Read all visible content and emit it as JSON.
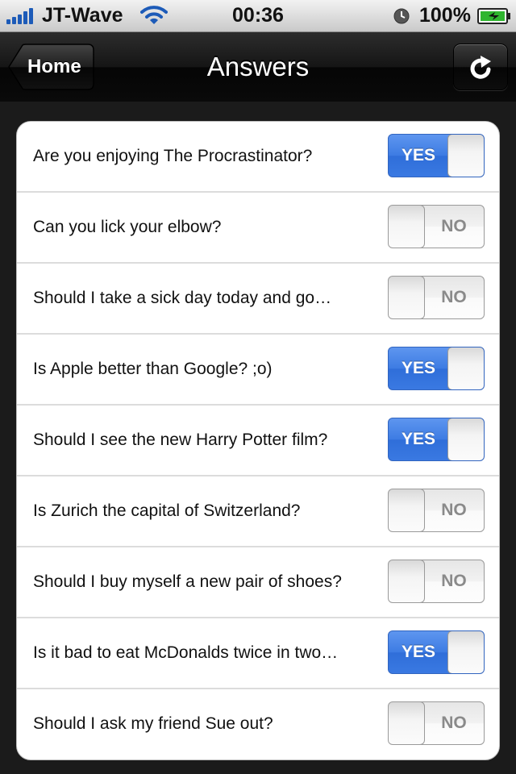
{
  "status_bar": {
    "carrier": "JT-Wave",
    "time": "00:36",
    "battery": "100%",
    "icons": [
      "signal-icon",
      "wifi-icon",
      "alarm-clock-icon",
      "battery-charging-icon"
    ]
  },
  "nav": {
    "back_label": "Home",
    "title": "Answers",
    "refresh_icon": "refresh-icon"
  },
  "colors": {
    "toggle_on": "#3d7ce3",
    "navbar": "#151515",
    "background": "#1b1b1b"
  },
  "rows": [
    {
      "question": "Are you enjoying The Procrastinator?",
      "answer": "YES",
      "on": true
    },
    {
      "question": "Can you lick your elbow?",
      "answer": "NO",
      "on": false
    },
    {
      "question": "Should I take a sick day today and go…",
      "answer": "NO",
      "on": false
    },
    {
      "question": "Is Apple better than Google? ;o)",
      "answer": "YES",
      "on": true
    },
    {
      "question": "Should I see the new Harry Potter film?",
      "answer": "YES",
      "on": true
    },
    {
      "question": "Is Zurich the capital of Switzerland?",
      "answer": "NO",
      "on": false
    },
    {
      "question": "Should I buy myself a new pair of shoes?",
      "answer": "NO",
      "on": false
    },
    {
      "question": "Is it bad to eat McDonalds twice in two…",
      "answer": "YES",
      "on": true
    },
    {
      "question": "Should I ask my friend Sue out?",
      "answer": "NO",
      "on": false
    }
  ]
}
